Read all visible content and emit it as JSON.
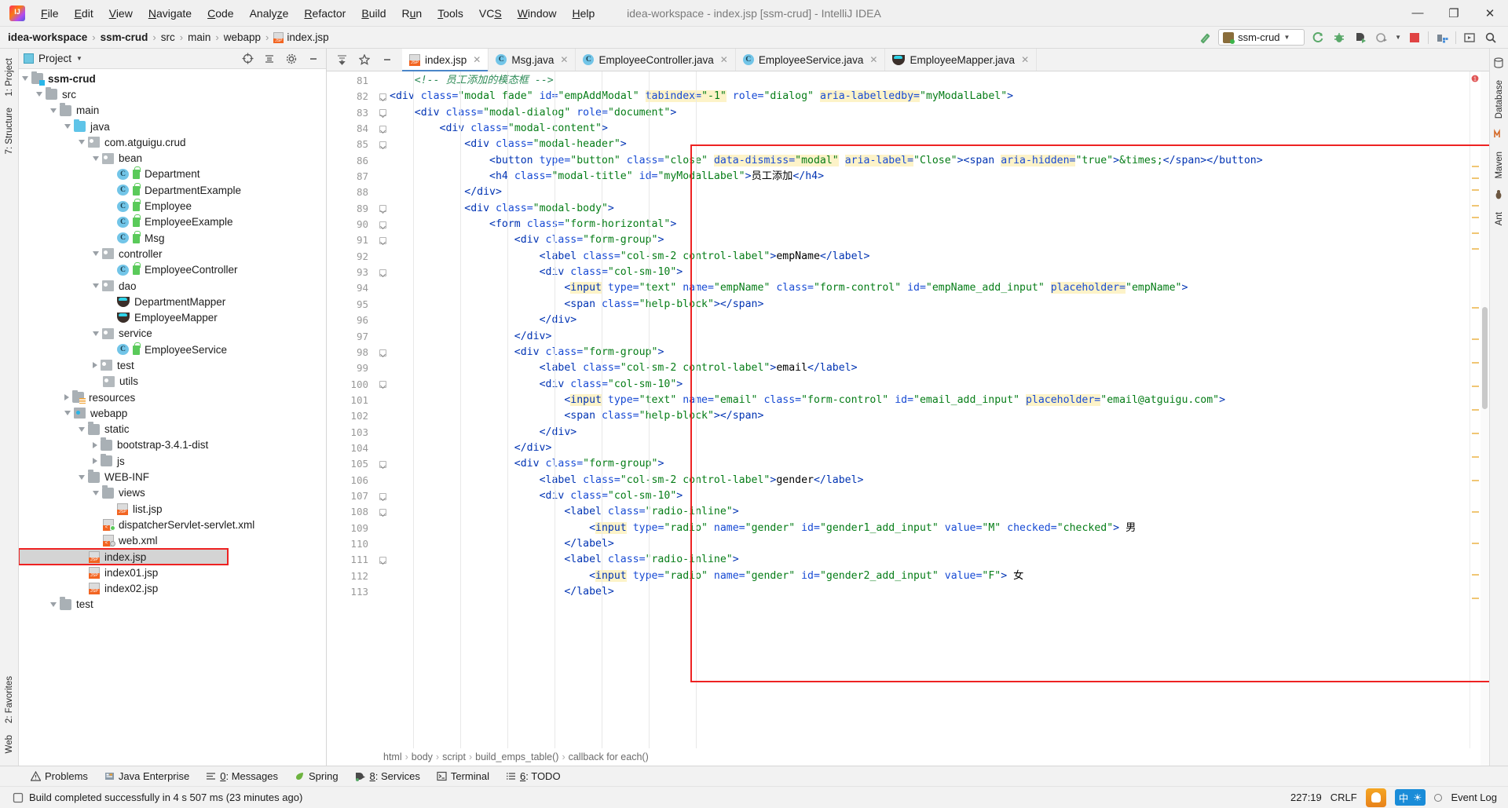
{
  "window": {
    "title": "idea-workspace - index.jsp [ssm-crud] - IntelliJ IDEA",
    "minimize": "—",
    "maximize": "❐",
    "close": "✕"
  },
  "menubar": [
    {
      "label": "File"
    },
    {
      "label": "Edit"
    },
    {
      "label": "View"
    },
    {
      "label": "Navigate"
    },
    {
      "label": "Code"
    },
    {
      "label": "Analyze"
    },
    {
      "label": "Refactor"
    },
    {
      "label": "Build"
    },
    {
      "label": "Run"
    },
    {
      "label": "Tools"
    },
    {
      "label": "VCS"
    },
    {
      "label": "Window"
    },
    {
      "label": "Help"
    }
  ],
  "breadcrumb": {
    "items": [
      "idea-workspace",
      "ssm-crud",
      "src",
      "main",
      "webapp",
      "index.jsp"
    ],
    "separator": "›"
  },
  "toolbar": {
    "run_config": "ssm-crud",
    "icons": [
      "hammer-icon",
      "run-icon",
      "debug-icon",
      "run-with-coverage-icon",
      "profile-icon",
      "stop-icon",
      "update-icon",
      "select-opened-file-icon",
      "search-everywhere-icon"
    ]
  },
  "left_rail": [
    "1: Project",
    "7: Structure"
  ],
  "left_rail_bottom": [
    "2: Favorites",
    "Web"
  ],
  "right_rail": [
    "Database",
    "Maven",
    "Ant"
  ],
  "project_panel": {
    "title": "Project",
    "tree": [
      {
        "indent": 1,
        "arrow": "down",
        "icon": "module-folder",
        "label": "ssm-crud",
        "bold": true
      },
      {
        "indent": 2,
        "arrow": "down",
        "icon": "folder",
        "label": "src"
      },
      {
        "indent": 3,
        "arrow": "down",
        "icon": "folder",
        "label": "main"
      },
      {
        "indent": 4,
        "arrow": "down",
        "icon": "source-folder",
        "label": "java"
      },
      {
        "indent": 5,
        "arrow": "down",
        "icon": "package",
        "label": "com.atguigu.crud"
      },
      {
        "indent": 6,
        "arrow": "down",
        "icon": "package",
        "label": "bean"
      },
      {
        "indent": 7,
        "arrow": "none",
        "icon": "class",
        "label": "Department"
      },
      {
        "indent": 7,
        "arrow": "none",
        "icon": "class",
        "label": "DepartmentExample"
      },
      {
        "indent": 7,
        "arrow": "none",
        "icon": "class",
        "label": "Employee"
      },
      {
        "indent": 7,
        "arrow": "none",
        "icon": "class",
        "label": "EmployeeExample"
      },
      {
        "indent": 7,
        "arrow": "none",
        "icon": "class",
        "label": "Msg"
      },
      {
        "indent": 6,
        "arrow": "down",
        "icon": "package",
        "label": "controller"
      },
      {
        "indent": 7,
        "arrow": "none",
        "icon": "class",
        "label": "EmployeeController"
      },
      {
        "indent": 6,
        "arrow": "down",
        "icon": "package",
        "label": "dao"
      },
      {
        "indent": 7,
        "arrow": "none",
        "icon": "mybatis",
        "label": "DepartmentMapper"
      },
      {
        "indent": 7,
        "arrow": "none",
        "icon": "mybatis",
        "label": "EmployeeMapper"
      },
      {
        "indent": 6,
        "arrow": "down",
        "icon": "package",
        "label": "service"
      },
      {
        "indent": 7,
        "arrow": "none",
        "icon": "class",
        "label": "EmployeeService"
      },
      {
        "indent": 6,
        "arrow": "right",
        "icon": "package",
        "label": "test"
      },
      {
        "indent": 6,
        "arrow": "none",
        "icon": "package",
        "label": "utils"
      },
      {
        "indent": 4,
        "arrow": "right",
        "icon": "resource-folder",
        "label": "resources"
      },
      {
        "indent": 4,
        "arrow": "down",
        "icon": "web-folder",
        "label": "webapp"
      },
      {
        "indent": 5,
        "arrow": "down",
        "icon": "folder",
        "label": "static"
      },
      {
        "indent": 6,
        "arrow": "right",
        "icon": "folder",
        "label": "bootstrap-3.4.1-dist"
      },
      {
        "indent": 6,
        "arrow": "right",
        "icon": "folder",
        "label": "js"
      },
      {
        "indent": 5,
        "arrow": "down",
        "icon": "folder",
        "label": "WEB-INF"
      },
      {
        "indent": 6,
        "arrow": "down",
        "icon": "folder",
        "label": "views"
      },
      {
        "indent": 7,
        "arrow": "none",
        "icon": "jsp",
        "label": "list.jsp"
      },
      {
        "indent": 6,
        "arrow": "none",
        "icon": "xml-spring",
        "label": "dispatcherServlet-servlet.xml"
      },
      {
        "indent": 6,
        "arrow": "none",
        "icon": "xml-web",
        "label": "web.xml"
      },
      {
        "indent": 5,
        "arrow": "none",
        "icon": "jsp",
        "label": "index.jsp",
        "selected": true,
        "boxed": true
      },
      {
        "indent": 5,
        "arrow": "none",
        "icon": "jsp",
        "label": "index01.jsp"
      },
      {
        "indent": 5,
        "arrow": "none",
        "icon": "jsp",
        "label": "index02.jsp"
      },
      {
        "indent": 3,
        "arrow": "down",
        "icon": "folder",
        "label": "test"
      }
    ]
  },
  "editor_tabs": [
    {
      "label": "index.jsp",
      "icon": "jsp-icon",
      "active": true,
      "closable": true
    },
    {
      "label": "Msg.java",
      "icon": "class-icon",
      "active": false,
      "closable": true
    },
    {
      "label": "EmployeeController.java",
      "icon": "class-icon",
      "active": false,
      "closable": true
    },
    {
      "label": "EmployeeService.java",
      "icon": "class-icon",
      "active": false,
      "closable": true
    },
    {
      "label": "EmployeeMapper.java",
      "icon": "mybatis-icon",
      "active": false,
      "closable": true
    }
  ],
  "editor": {
    "first_line": 81,
    "lines": [
      {
        "n": 81,
        "fold": false,
        "html": "    <span class='cmt-g'>&lt;!-- 员工添加的模态框 --&gt;</span>"
      },
      {
        "n": 82,
        "fold": true,
        "html": "<span class='tag'>&lt;div</span> <span class='attr'>class=</span><span class='val'>\"modal fade\"</span> <span class='attr'>id=</span><span class='val'>\"empAddModal\"</span> <span class='hl'><span class='attr'>tabindex=</span><span class='val'>\"-1\"</span></span> <span class='attr'>role=</span><span class='val'>\"dialog\"</span> <span class='hl'><span class='attr'>aria-labelledby=</span></span><span class='val'>\"myModalLabel\"</span><span class='tag'>&gt;</span>"
      },
      {
        "n": 83,
        "fold": true,
        "html": "    <span class='tag'>&lt;div</span> <span class='attr'>class=</span><span class='val'>\"modal-dialog\"</span> <span class='attr'>role=</span><span class='val'>\"document\"</span><span class='tag'>&gt;</span>"
      },
      {
        "n": 84,
        "fold": true,
        "html": "        <span class='tag'>&lt;div</span> <span class='attr'>class=</span><span class='val'>\"modal-content\"</span><span class='tag'>&gt;</span>"
      },
      {
        "n": 85,
        "fold": true,
        "html": "            <span class='tag'>&lt;div</span> <span class='attr'>class=</span><span class='val'>\"modal-header\"</span><span class='tag'>&gt;</span>"
      },
      {
        "n": 86,
        "fold": false,
        "html": "                <span class='tag'>&lt;button</span> <span class='attr'>type=</span><span class='val'>\"button\"</span> <span class='attr'>class=</span><span class='val'>\"close\"</span> <span class='hl'><span class='attr'>data-dismiss=</span><span class='val'>\"modal\"</span></span> <span class='hl'><span class='attr'>aria-label=</span></span><span class='val'>\"Close\"</span><span class='tag'>&gt;&lt;span</span> <span class='hl'><span class='attr'>aria-hidden=</span></span><span class='val'>\"true\"</span><span class='tag'>&gt;</span><span class='val'>&amp;times;</span><span class='tag'>&lt;/span&gt;&lt;/button&gt;</span>"
      },
      {
        "n": 87,
        "fold": false,
        "html": "                <span class='tag'>&lt;h4</span> <span class='attr'>class=</span><span class='val'>\"modal-title\"</span> <span class='attr'>id=</span><span class='val'>\"myModalLabel\"</span><span class='tag'>&gt;</span><span class='txt'>员工添加</span><span class='tag'>&lt;/h4&gt;</span>"
      },
      {
        "n": 88,
        "fold": false,
        "html": "            <span class='tag'>&lt;/div&gt;</span>"
      },
      {
        "n": 89,
        "fold": true,
        "html": "            <span class='tag'>&lt;div</span> <span class='attr'>class=</span><span class='val'>\"modal-body\"</span><span class='tag'>&gt;</span>"
      },
      {
        "n": 90,
        "fold": true,
        "html": "                <span class='tag'>&lt;form</span> <span class='attr'>class=</span><span class='val'>\"form-horizontal\"</span><span class='tag'>&gt;</span>"
      },
      {
        "n": 91,
        "fold": true,
        "html": "                    <span class='tag'>&lt;div</span> <span class='attr'>class=</span><span class='val'>\"form-group\"</span><span class='tag'>&gt;</span>"
      },
      {
        "n": 92,
        "fold": false,
        "html": "                        <span class='tag'>&lt;label</span> <span class='attr'>class=</span><span class='val'>\"col-sm-2 control-label\"</span><span class='tag'>&gt;</span><span class='txt'>empName</span><span class='tag'>&lt;/label&gt;</span>"
      },
      {
        "n": 93,
        "fold": true,
        "html": "                        <span class='tag'>&lt;div</span> <span class='attr'>class=</span><span class='val'>\"col-sm-10\"</span><span class='tag'>&gt;</span>"
      },
      {
        "n": 94,
        "fold": false,
        "html": "                            <span class='tag'>&lt;</span><span class='hl'><span class='tag'>input</span></span> <span class='attr'>type=</span><span class='val'>\"text\"</span> <span class='attr'>name=</span><span class='val'>\"empName\"</span> <span class='attr'>class=</span><span class='val'>\"form-control\"</span> <span class='attr'>id=</span><span class='val'>\"empName_add_input\"</span> <span class='hl'><span class='attr'>placeholder=</span></span><span class='val'>\"empName\"</span><span class='tag'>&gt;</span>"
      },
      {
        "n": 95,
        "fold": false,
        "html": "                            <span class='tag'>&lt;span</span> <span class='attr'>class=</span><span class='val'>\"help-block\"</span><span class='tag'>&gt;&lt;/span&gt;</span>"
      },
      {
        "n": 96,
        "fold": false,
        "html": "                        <span class='tag'>&lt;/div&gt;</span>"
      },
      {
        "n": 97,
        "fold": false,
        "html": "                    <span class='tag'>&lt;/div&gt;</span>"
      },
      {
        "n": 98,
        "fold": true,
        "html": "                    <span class='tag'>&lt;div</span> <span class='attr'>class=</span><span class='val'>\"form-group\"</span><span class='tag'>&gt;</span>"
      },
      {
        "n": 99,
        "fold": false,
        "html": "                        <span class='tag'>&lt;label</span> <span class='attr'>class=</span><span class='val'>\"col-sm-2 control-label\"</span><span class='tag'>&gt;</span><span class='txt'>email</span><span class='tag'>&lt;/label&gt;</span>"
      },
      {
        "n": 100,
        "fold": true,
        "html": "                        <span class='tag'>&lt;div</span> <span class='attr'>class=</span><span class='val'>\"col-sm-10\"</span><span class='tag'>&gt;</span>"
      },
      {
        "n": 101,
        "fold": false,
        "html": "                            <span class='tag'>&lt;</span><span class='hl'><span class='tag'>input</span></span> <span class='attr'>type=</span><span class='val'>\"text\"</span> <span class='attr'>name=</span><span class='val'>\"email\"</span> <span class='attr'>class=</span><span class='val'>\"form-control\"</span> <span class='attr'>id=</span><span class='val'>\"email_add_input\"</span> <span class='hl'><span class='attr'>placeholder=</span></span><span class='val'>\"email@atguigu.com\"</span><span class='tag'>&gt;</span>"
      },
      {
        "n": 102,
        "fold": false,
        "html": "                            <span class='tag'>&lt;span</span> <span class='attr'>class=</span><span class='val'>\"help-block\"</span><span class='tag'>&gt;&lt;/span&gt;</span>"
      },
      {
        "n": 103,
        "fold": false,
        "html": "                        <span class='tag'>&lt;/div&gt;</span>"
      },
      {
        "n": 104,
        "fold": false,
        "html": "                    <span class='tag'>&lt;/div&gt;</span>"
      },
      {
        "n": 105,
        "fold": true,
        "html": "                    <span class='tag'>&lt;div</span> <span class='attr'>class=</span><span class='val'>\"form-group\"</span><span class='tag'>&gt;</span>"
      },
      {
        "n": 106,
        "fold": false,
        "html": "                        <span class='tag'>&lt;label</span> <span class='attr'>class=</span><span class='val'>\"col-sm-2 control-label\"</span><span class='tag'>&gt;</span><span class='txt'>gender</span><span class='tag'>&lt;/label&gt;</span>"
      },
      {
        "n": 107,
        "fold": true,
        "html": "                        <span class='tag'>&lt;div</span> <span class='attr'>class=</span><span class='val'>\"col-sm-10\"</span><span class='tag'>&gt;</span>"
      },
      {
        "n": 108,
        "fold": true,
        "html": "                            <span class='tag'>&lt;label</span> <span class='attr'>class=</span><span class='val'>\"radio-inline\"</span><span class='tag'>&gt;</span>"
      },
      {
        "n": 109,
        "fold": false,
        "html": "                                <span class='tag'>&lt;</span><span class='hl'><span class='tag'>input</span></span> <span class='attr'>type=</span><span class='val'>\"radio\"</span> <span class='attr'>name=</span><span class='val'>\"gender\"</span> <span class='attr'>id=</span><span class='val'>\"gender1_add_input\"</span> <span class='attr'>value=</span><span class='val'>\"M\"</span> <span class='attr'>checked=</span><span class='val'>\"checked\"</span><span class='tag'>&gt;</span><span class='txt'> 男</span>"
      },
      {
        "n": 110,
        "fold": false,
        "html": "                            <span class='tag'>&lt;/label&gt;</span>"
      },
      {
        "n": 111,
        "fold": true,
        "html": "                            <span class='tag'>&lt;label</span> <span class='attr'>class=</span><span class='val'>\"radio-inline\"</span><span class='tag'>&gt;</span>"
      },
      {
        "n": 112,
        "fold": false,
        "html": "                                <span class='tag'>&lt;</span><span class='hl'><span class='tag'>input</span></span> <span class='attr'>type=</span><span class='val'>\"radio\"</span> <span class='attr'>name=</span><span class='val'>\"gender\"</span> <span class='attr'>id=</span><span class='val'>\"gender2_add_input\"</span> <span class='attr'>value=</span><span class='val'>\"F\"</span><span class='tag'>&gt;</span><span class='txt'> 女</span>"
      },
      {
        "n": 113,
        "fold": false,
        "html": "                            <span class='tag'>&lt;/label&gt;</span>"
      }
    ],
    "bottom_breadcrumb": [
      "html",
      "body",
      "script",
      "build_emps_table()",
      "callback for each()"
    ]
  },
  "tool_windows": [
    {
      "label": "Problems",
      "icon": "warning-icon",
      "mnemonic": ""
    },
    {
      "label": "Java Enterprise",
      "icon": "java-ee-icon",
      "mnemonic": ""
    },
    {
      "label": "Messages",
      "icon": "messages-icon",
      "mnemonic": "0"
    },
    {
      "label": "Spring",
      "icon": "spring-leaf-icon",
      "mnemonic": ""
    },
    {
      "label": "Services",
      "icon": "services-icon",
      "mnemonic": "8"
    },
    {
      "label": "Terminal",
      "icon": "terminal-icon",
      "mnemonic": ""
    },
    {
      "label": "TODO",
      "icon": "todo-icon",
      "mnemonic": "6"
    }
  ],
  "statusbar": {
    "message": "Build completed successfully in 4 s 507 ms (23 minutes ago)",
    "caret_position": "227:19",
    "line_separator": "CRLF",
    "ime_lang": "中",
    "ime_extra": "☀",
    "event_log": "Event Log"
  },
  "colors": {
    "accent_blue": "#4a86c8",
    "error_red": "#ee2222",
    "tag_blue": "#0033b3",
    "string_green": "#067d17",
    "comment_green": "#2e8b57",
    "highlight_yellow": "#fdf3c8",
    "selection_gray": "#d4d4d4"
  }
}
